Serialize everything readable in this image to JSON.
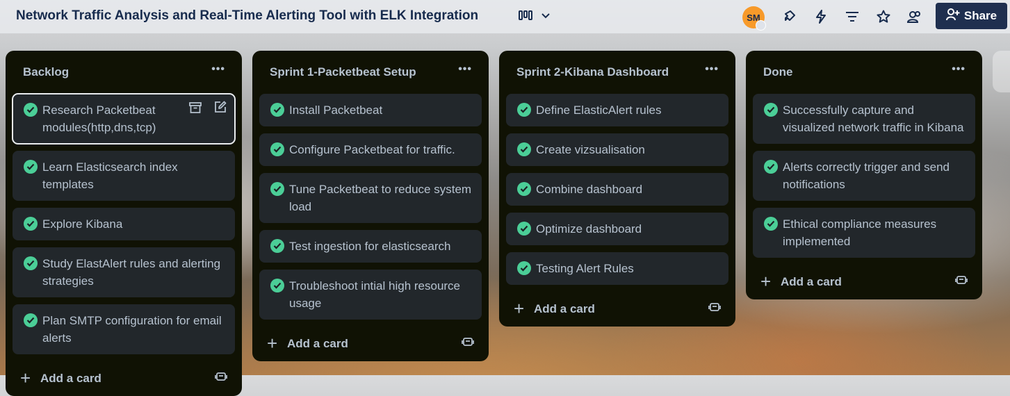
{
  "board": {
    "title": "Network Traffic Analysis and Real-Time Alerting Tool with ELK Integration"
  },
  "header": {
    "avatar_initials": "SM",
    "share_label": "Share",
    "icons": [
      "view-switcher-icon",
      "chevron-down-icon",
      "power-ups-icon",
      "automation-icon",
      "filter-icon",
      "star-icon",
      "visibility-icon",
      "add-member-icon"
    ]
  },
  "colors": {
    "list_bg": "#101204",
    "card_bg": "#22272b",
    "check_green": "#4bce97",
    "share_bg": "#1f2f4f",
    "avatar_bg": "#f79a2a"
  },
  "lists": [
    {
      "title": "Backlog",
      "cards": [
        "Research Packetbeat modules(http,dns,tcp)",
        "Learn Elasticsearch index templates",
        "Explore Kibana",
        "Study ElastAlert rules and alerting strategies",
        "Plan SMTP configuration for email alerts"
      ],
      "add_label": "Add a card"
    },
    {
      "title": "Sprint 1-Packetbeat Setup",
      "cards": [
        "Install Packetbeat",
        "Configure Packetbeat for traffic.",
        "Tune Packetbeat to reduce system load",
        "Test ingestion for elasticsearch",
        "Troubleshoot intial high resource usage"
      ],
      "add_label": "Add a card"
    },
    {
      "title": "Sprint 2-Kibana Dashboard",
      "cards": [
        "Define ElasticAlert rules",
        "Create vizsualisation",
        "Combine dashboard",
        "Optimize dashboard",
        "Testing Alert Rules"
      ],
      "add_label": "Add a card"
    },
    {
      "title": "Done",
      "cards": [
        "Successfully capture and visualized network traffic in Kibana",
        "Alerts correctly trigger and send notifications",
        "Ethical compliance measures implemented"
      ],
      "add_label": "Add a card"
    }
  ]
}
